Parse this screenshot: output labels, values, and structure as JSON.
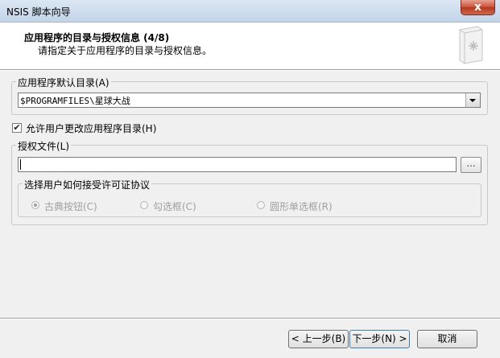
{
  "window": {
    "title": "NSIS 脚本向导",
    "close_glyph": "x"
  },
  "header": {
    "title": "应用程序的目录与授权信息 (4/8)",
    "subtitle": "请指定关于应用程序的目录与授权信息。"
  },
  "dir_group": {
    "label": "应用程序默认目录(A)",
    "value": "$PROGRAMFILES\\星球大战"
  },
  "allow_change": {
    "label": "允许用户更改应用程序目录(H)",
    "checked": true,
    "glyph": "✔"
  },
  "license_group": {
    "label": "授权文件(L)",
    "value": "",
    "browse_label": "...",
    "accept_group": {
      "label": "选择用户如何接受许可证协议",
      "options": [
        {
          "label": "古典按钮(C)",
          "selected": true
        },
        {
          "label": "勾选框(C)",
          "selected": false
        },
        {
          "label": "圆形单选框(R)",
          "selected": false
        }
      ]
    }
  },
  "buttons": {
    "back": "< 上一步(B)",
    "next": "下一步(N) >",
    "cancel": "取消"
  }
}
